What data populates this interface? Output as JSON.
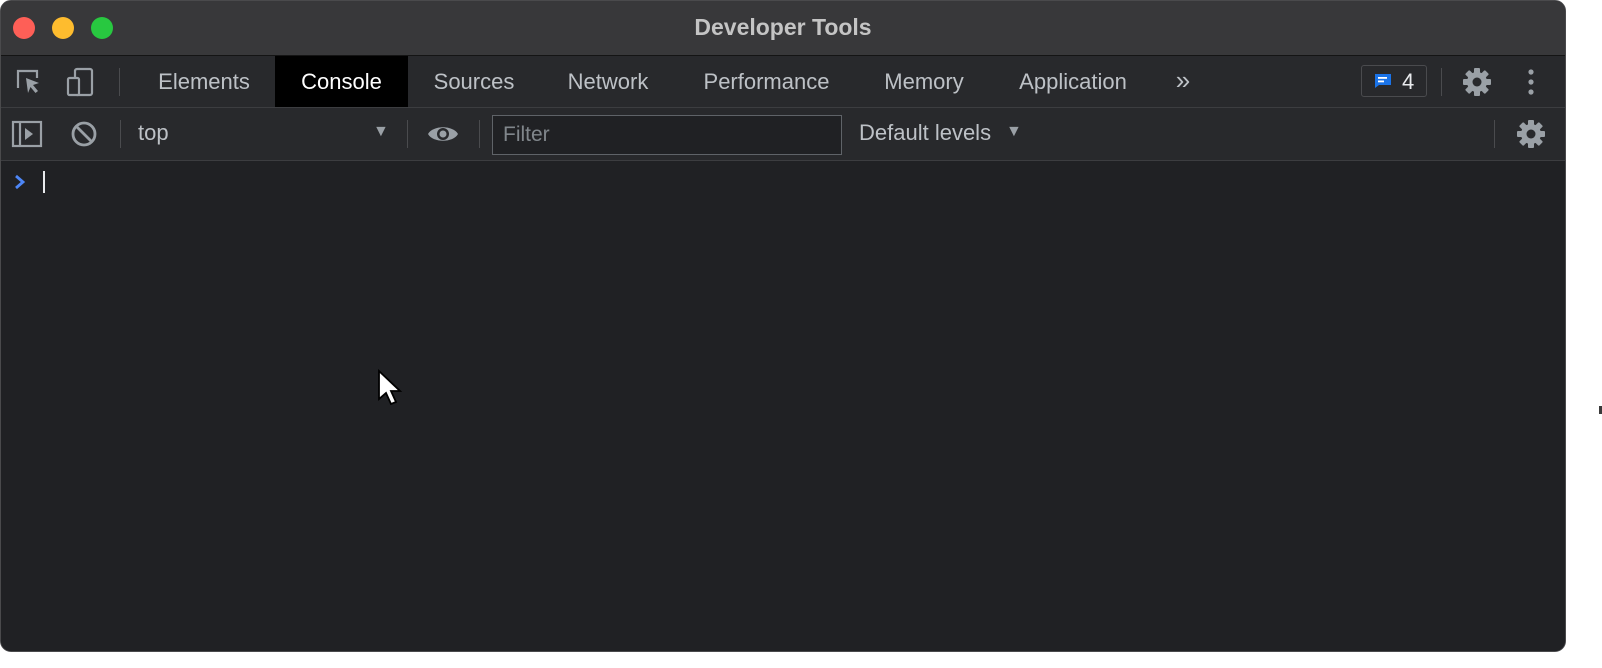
{
  "window": {
    "title": "Developer Tools"
  },
  "tabs": [
    {
      "label": "Elements",
      "active": false
    },
    {
      "label": "Console",
      "active": true
    },
    {
      "label": "Sources",
      "active": false
    },
    {
      "label": "Network",
      "active": false
    },
    {
      "label": "Performance",
      "active": false
    },
    {
      "label": "Memory",
      "active": false
    },
    {
      "label": "Application",
      "active": false
    }
  ],
  "toolbar": {
    "more_tabs_icon": "chevron-double-right-icon",
    "issues_count": "4",
    "issues_icon": "message-icon",
    "settings_icon": "gear-icon",
    "menu_icon": "kebab-menu-icon",
    "inspect_icon": "inspect-element-icon",
    "device_icon": "device-toolbar-icon"
  },
  "console_toolbar": {
    "context": "top",
    "filter_placeholder": "Filter",
    "filter_value": "",
    "levels_label": "Default levels",
    "sidebar_icon": "show-sidebar-icon",
    "clear_icon": "clear-console-icon",
    "live_expression_icon": "eye-icon",
    "settings_icon": "gear-icon"
  },
  "console": {
    "input_value": ""
  },
  "colors": {
    "accent": "#1a73e8",
    "prompt": "#4d86f7",
    "background": "#202124",
    "toolbar": "#28292c"
  }
}
